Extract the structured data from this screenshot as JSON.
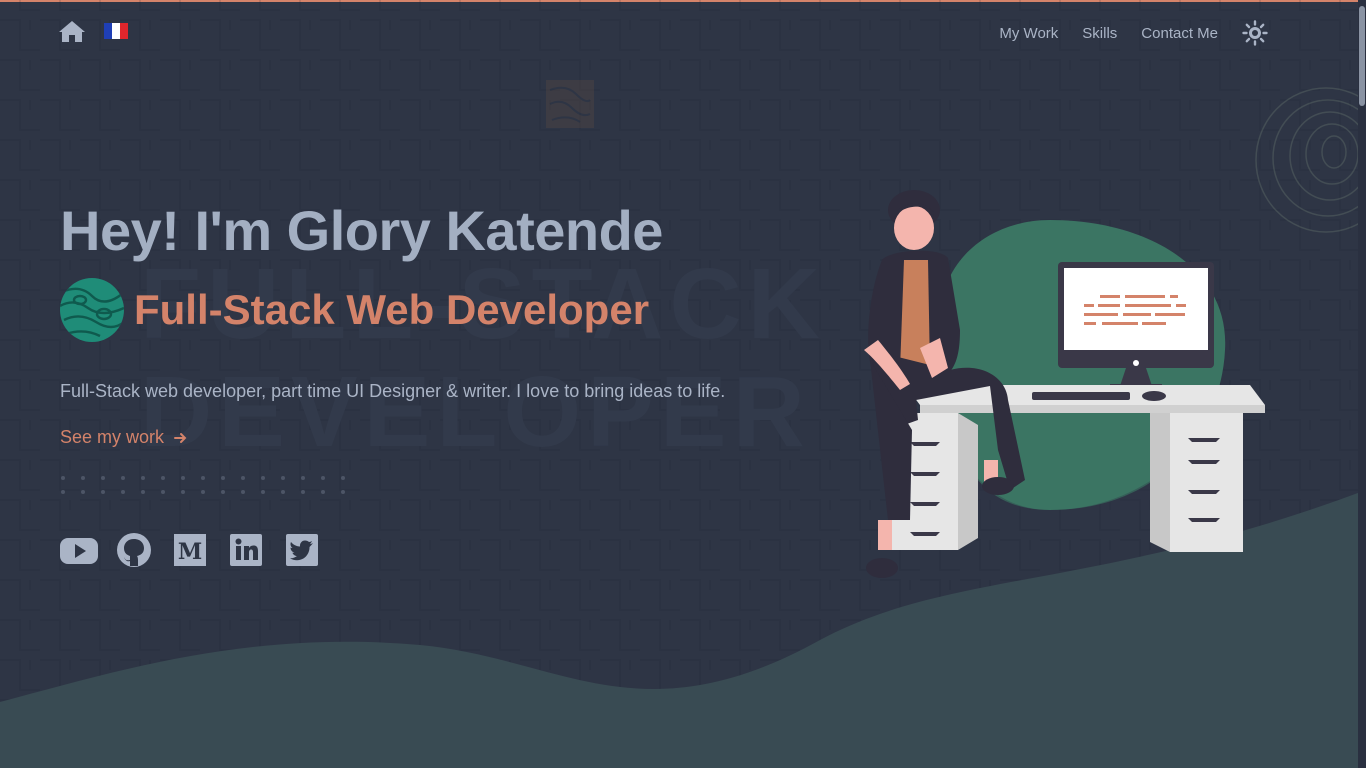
{
  "nav": {
    "home_icon": "home-icon",
    "language_flag": "france-flag",
    "links": [
      "My Work",
      "Skills",
      "Contact Me"
    ],
    "theme_icon": "sun-icon"
  },
  "hero": {
    "title": "Hey! I'm Glory Katende",
    "role": "Full-Stack Web Developer",
    "intro": "Full-Stack web developer, part time UI Designer & writer. I love to bring ideas to life.",
    "cta": "See my work",
    "watermark_lines": [
      "FULL-STACK",
      "DEVELOPER"
    ]
  },
  "socials": [
    {
      "name": "youtube-icon"
    },
    {
      "name": "github-icon"
    },
    {
      "name": "medium-icon"
    },
    {
      "name": "linkedin-icon"
    },
    {
      "name": "twitter-icon"
    }
  ],
  "colors": {
    "background": "#2e3545",
    "accent": "#d4836a",
    "text_muted": "#aab4c6",
    "heading": "#a3afc2",
    "wave": "#394b53",
    "green_blob": "#3b7563"
  }
}
